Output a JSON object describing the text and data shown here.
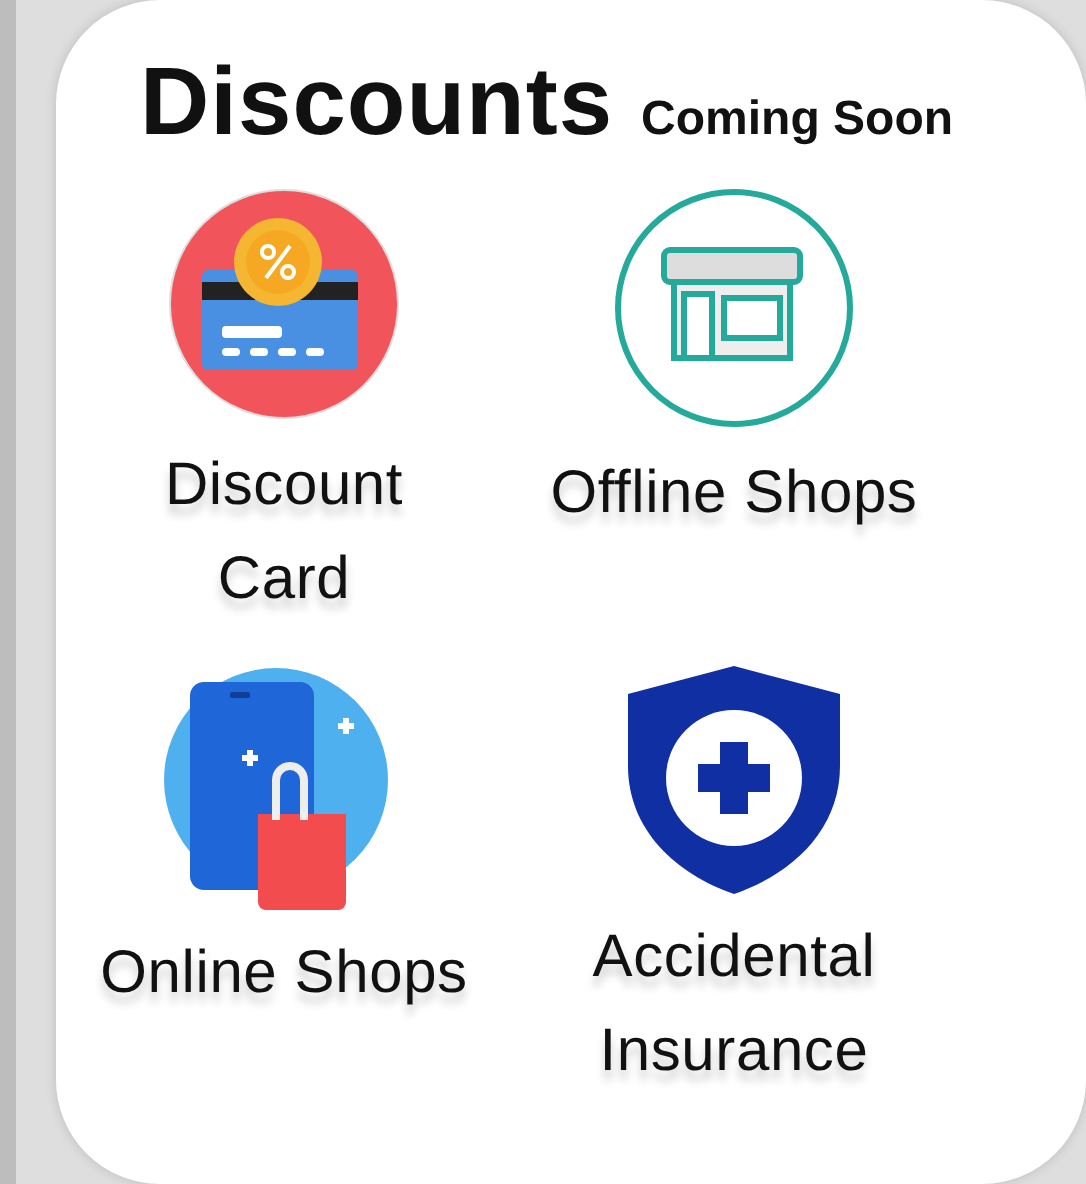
{
  "title": "Discounts",
  "badge": "Coming Soon",
  "items": [
    {
      "kind": "card",
      "label": "Discount Card"
    },
    {
      "kind": "store",
      "label": "Offline Shops"
    },
    {
      "kind": "online",
      "label": "Online Shops"
    },
    {
      "kind": "shield",
      "label": "Accidental Insurance"
    }
  ]
}
